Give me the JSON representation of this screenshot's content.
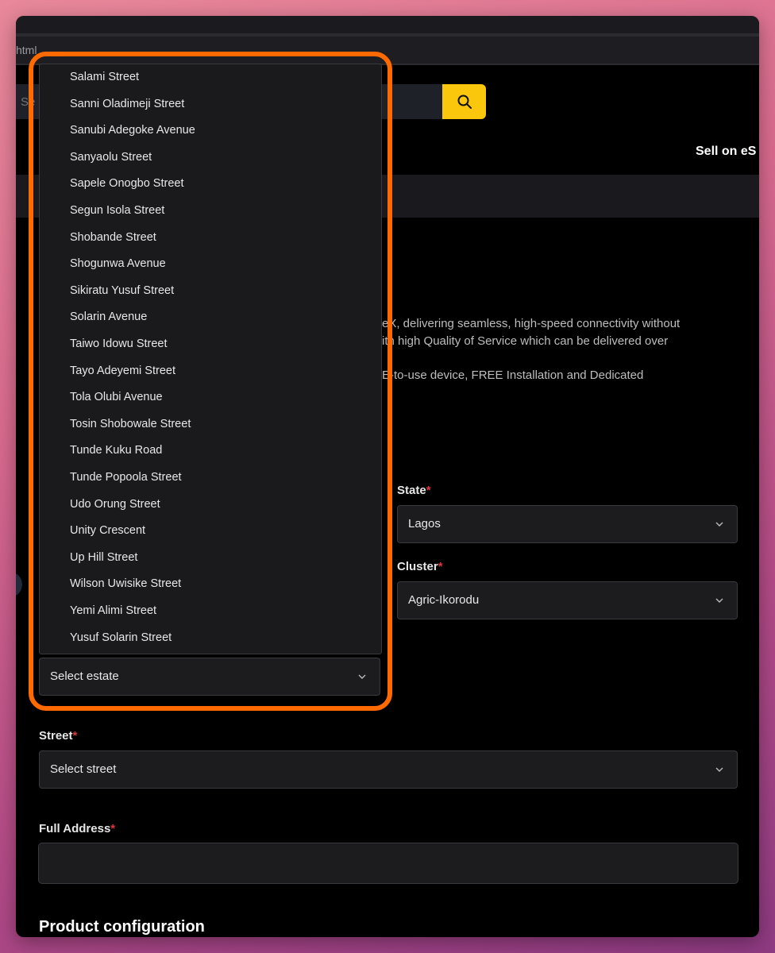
{
  "browser": {
    "url_fragment": "html"
  },
  "header": {
    "search_placeholder": "Se",
    "sell_link": "Sell on eS"
  },
  "description": {
    "line1": "eX, delivering seamless, high-speed connectivity without",
    "line2": "ith high Quality of Service which can be delivered over",
    "line3": "E-to-use device, FREE Installation and Dedicated"
  },
  "form": {
    "state_label": "State",
    "state_value": "Lagos",
    "cluster_label": "Cluster",
    "cluster_value": "Agric-Ikorodu",
    "estate_value": "Select estate",
    "street_label": "Street",
    "street_value": "Select street",
    "full_address_label": "Full Address",
    "required_mark": "*"
  },
  "dropdown": {
    "options": [
      "Salami Street",
      "Sanni Oladimeji Street",
      "Sanubi Adegoke Avenue",
      "Sanyaolu Street",
      "Sapele Onogbo Street",
      "Segun Isola Street",
      "Shobande Street",
      "Shogunwa Avenue",
      "Sikiratu Yusuf Street",
      "Solarin Avenue",
      "Taiwo Idowu Street",
      "Tayo Adeyemi Street",
      "Tola Olubi Avenue",
      "Tosin Shobowale Street",
      "Tunde Kuku Road",
      "Tunde Popoola Street",
      "Udo Orung Street",
      "Unity Crescent",
      "Up Hill Street",
      "Wilson Uwisike Street",
      "Yemi Alimi Street",
      "Yusuf Solarin Street"
    ]
  },
  "section": {
    "product_configuration": "Product configuration"
  },
  "colors": {
    "accent_yellow": "#fbc70c",
    "highlight_orange": "#ff6a00",
    "required_red": "#e0353b"
  },
  "icons": {
    "search": "search-icon",
    "chevron": "chevron-down-icon"
  }
}
